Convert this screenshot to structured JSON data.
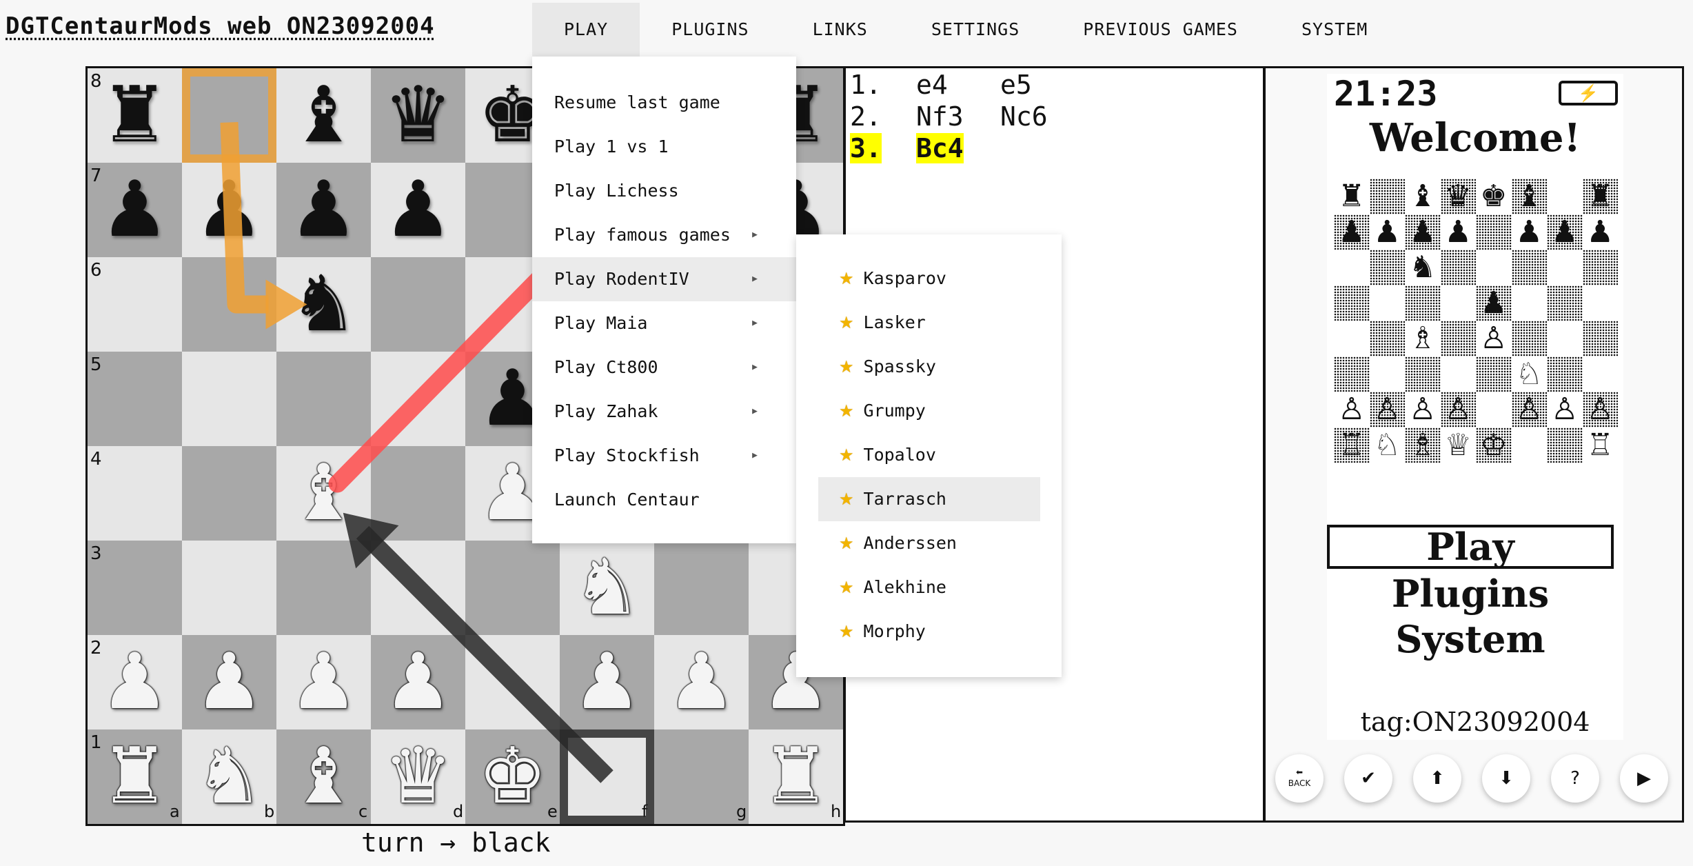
{
  "brand": "DGTCentaurMods web ON23092004",
  "nav": [
    "PLAY",
    "PLUGINS",
    "LINKS",
    "SETTINGS",
    "PREVIOUS GAMES",
    "SYSTEM"
  ],
  "play_menu": {
    "items": [
      {
        "label": "Resume last game",
        "submenu": false
      },
      {
        "label": "Play 1 vs 1",
        "submenu": false
      },
      {
        "label": "Play Lichess",
        "submenu": false
      },
      {
        "label": "Play famous games",
        "submenu": true
      },
      {
        "label": "Play RodentIV",
        "submenu": true
      },
      {
        "label": "Play Maia",
        "submenu": true
      },
      {
        "label": "Play Ct800",
        "submenu": true
      },
      {
        "label": "Play Zahak",
        "submenu": true
      },
      {
        "label": "Play Stockfish",
        "submenu": true
      },
      {
        "label": "Launch Centaur",
        "submenu": false
      }
    ],
    "active": "Play RodentIV"
  },
  "rodent_submenu": {
    "items": [
      "Kasparov",
      "Lasker",
      "Spassky",
      "Grumpy",
      "Topalov",
      "Tarrasch",
      "Anderssen",
      "Alekhine",
      "Morphy"
    ],
    "active": "Tarrasch",
    "icon": "star-icon"
  },
  "board": {
    "files": [
      "a",
      "b",
      "c",
      "d",
      "e",
      "f",
      "g",
      "h"
    ],
    "ranks": [
      "8",
      "7",
      "6",
      "5",
      "4",
      "3",
      "2",
      "1"
    ],
    "position": [
      "r.bqkb.r",
      "pppp.ppp",
      "..n.....",
      "....p...",
      "..B.P...",
      ".....N..",
      "PPPP.PPP",
      "RNBQK..R"
    ],
    "highlight_squares": {
      "b8": "#f0a032",
      "f1": "#282828"
    },
    "arrows": [
      {
        "from": "b8",
        "to": "c6",
        "color": "#f0a032",
        "style": "knight"
      },
      {
        "from": "f1",
        "to": "c4",
        "color": "#282828",
        "style": "straight"
      },
      {
        "from": "c4",
        "to": "f7",
        "color": "#ff4d4d",
        "style": "line"
      }
    ]
  },
  "turn_text": "turn → black",
  "moves": [
    {
      "num": "1.",
      "white": "e4",
      "black": "e5"
    },
    {
      "num": "2.",
      "white": "Nf3",
      "black": "Nc6"
    },
    {
      "num": "3.",
      "white": "Bc4",
      "black": "",
      "highlight": true
    }
  ],
  "device": {
    "time": "21:23",
    "battery_icon": "battery-charging-icon",
    "welcome": "Welcome!",
    "menu": [
      "Play",
      "Plugins",
      "System"
    ],
    "selected_menu": "Play",
    "tag": "tag:ON23092004",
    "buttons": [
      {
        "name": "back-icon",
        "label": "BACK",
        "glyph": "⬅"
      },
      {
        "name": "tick-icon",
        "glyph": "✔"
      },
      {
        "name": "arrow-up-icon",
        "glyph": "⬆"
      },
      {
        "name": "arrow-down-icon",
        "glyph": "⬇"
      },
      {
        "name": "help-icon",
        "glyph": "?"
      },
      {
        "name": "play-icon",
        "glyph": "▶"
      }
    ]
  }
}
